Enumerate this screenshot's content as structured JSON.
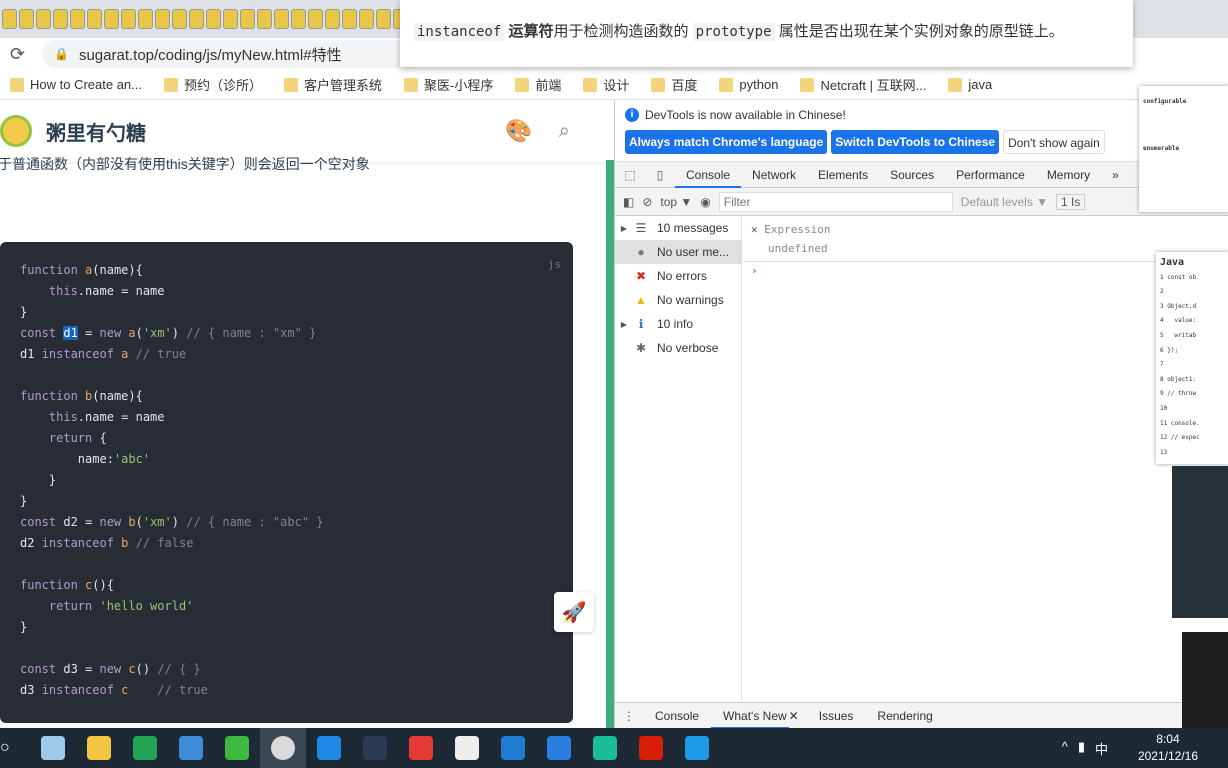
{
  "browser": {
    "url": "sugarat.top/coding/js/myNew.html#特性",
    "bookmarks": [
      "How to Create an...",
      "预约（诊所）",
      "客户管理系统",
      "聚医-小程序",
      "前端",
      "设计",
      "百度",
      "python",
      "Netcraft | 互联网...",
      "java"
    ]
  },
  "tooltip": {
    "code1": "instanceof",
    "bold": "运算符",
    "text1": "用于检测构造函数的",
    "code2": "prototype",
    "text2": "属性是否出现在某个实例对象的原型链上。"
  },
  "site": {
    "name": "粥里有勺糖",
    "intro": "于普通函数（内部没有使用this关键字）则会返回一个空对象",
    "code_lang": "js",
    "code_lines": [
      [
        [
          "function ",
          "k"
        ],
        [
          "a",
          "f"
        ],
        [
          "(name){",
          "p"
        ]
      ],
      [
        [
          "    this",
          "k"
        ],
        [
          ".name = name",
          "p"
        ]
      ],
      [
        [
          "}",
          "p"
        ]
      ],
      [
        [
          "const ",
          "k"
        ],
        [
          "d1",
          "sel"
        ],
        [
          " = ",
          "p"
        ],
        [
          "new ",
          "k"
        ],
        [
          "a",
          "f"
        ],
        [
          "(",
          "p"
        ],
        [
          "'xm'",
          "s"
        ],
        [
          ") ",
          "p"
        ],
        [
          "// { name : \"xm\" }",
          "c"
        ]
      ],
      [
        [
          "d1 ",
          "p"
        ],
        [
          "instanceof ",
          "k"
        ],
        [
          "a ",
          "f"
        ],
        [
          "// true",
          "c"
        ]
      ],
      [],
      [
        [
          "function ",
          "k"
        ],
        [
          "b",
          "f"
        ],
        [
          "(name){",
          "p"
        ]
      ],
      [
        [
          "    this",
          "k"
        ],
        [
          ".name = name",
          "p"
        ]
      ],
      [
        [
          "    return ",
          "k"
        ],
        [
          "{",
          "p"
        ]
      ],
      [
        [
          "        name:",
          "p"
        ],
        [
          "'abc'",
          "s"
        ]
      ],
      [
        [
          "    }",
          "p"
        ]
      ],
      [
        [
          "}",
          "p"
        ]
      ],
      [
        [
          "const ",
          "k"
        ],
        [
          "d2 = ",
          "p"
        ],
        [
          "new ",
          "k"
        ],
        [
          "b",
          "f"
        ],
        [
          "(",
          "p"
        ],
        [
          "'xm'",
          "s"
        ],
        [
          ") ",
          "p"
        ],
        [
          "// { name : \"abc\" }",
          "c"
        ]
      ],
      [
        [
          "d2 ",
          "p"
        ],
        [
          "instanceof ",
          "k"
        ],
        [
          "b ",
          "f"
        ],
        [
          "// false",
          "c"
        ]
      ],
      [],
      [
        [
          "function ",
          "k"
        ],
        [
          "c",
          "f"
        ],
        [
          "(){",
          "p"
        ]
      ],
      [
        [
          "    return ",
          "k"
        ],
        [
          "'hello world'",
          "s"
        ]
      ],
      [
        [
          "}",
          "p"
        ]
      ],
      [],
      [
        [
          "const ",
          "k"
        ],
        [
          "d3 = ",
          "p"
        ],
        [
          "new ",
          "k"
        ],
        [
          "c",
          "f"
        ],
        [
          "() ",
          "p"
        ],
        [
          "// { }",
          "c"
        ]
      ],
      [
        [
          "d3 ",
          "p"
        ],
        [
          "instanceof ",
          "k"
        ],
        [
          "c    ",
          "f"
        ],
        [
          "// true",
          "c"
        ]
      ]
    ]
  },
  "devtools": {
    "info": "DevTools is now available in Chinese!",
    "btn_match": "Always match Chrome's language",
    "btn_switch": "Switch DevTools to Chinese",
    "btn_dont": "Don't show again",
    "tabs": [
      "Console",
      "Network",
      "Elements",
      "Sources",
      "Performance",
      "Memory"
    ],
    "more": "»",
    "context": "top ▼",
    "filter_placeholder": "Filter",
    "levels": "Default levels ▼",
    "issues": "1 Is",
    "sidebar": [
      {
        "label": "10 messages",
        "icon": "list-icon",
        "glyph": "☰",
        "color": "#555",
        "expand": true
      },
      {
        "label": "No user me...",
        "icon": "user-icon",
        "glyph": "●",
        "color": "#777",
        "expand": false
      },
      {
        "label": "No errors",
        "icon": "error-icon",
        "glyph": "✖",
        "color": "#d93025",
        "expand": false
      },
      {
        "label": "No warnings",
        "icon": "warning-icon",
        "glyph": "▲",
        "color": "#f2b600",
        "expand": false
      },
      {
        "label": "10 info",
        "icon": "info-icon",
        "glyph": "ℹ",
        "color": "#1a73e8",
        "expand": true
      },
      {
        "label": "No verbose",
        "icon": "bug-icon",
        "glyph": "✱",
        "color": "#666",
        "expand": false
      }
    ],
    "expression_label": "Expression",
    "expression_value": "undefined",
    "drawer_tabs": [
      "Console",
      "What's New",
      "Issues",
      "Rendering"
    ]
  },
  "overlay": {
    "doc_terms": [
      "configurable",
      "enumerable"
    ],
    "code_title": "Java",
    "code_lines": [
      "const ob",
      "",
      "Object.d",
      "  value:",
      "  writab",
      "});",
      "",
      "object1.",
      "// throw",
      "",
      "console.",
      "// expec",
      ""
    ]
  },
  "taskbar": {
    "time": "8:04",
    "date": "2021/12/16",
    "ime": "中"
  }
}
